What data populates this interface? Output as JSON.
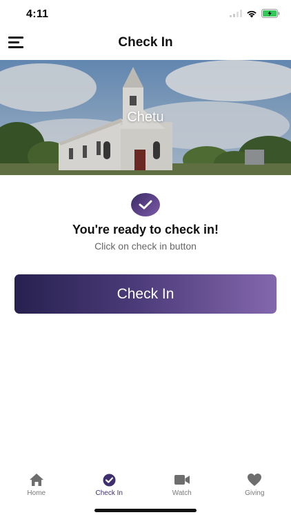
{
  "status_bar": {
    "time": "4:11"
  },
  "header": {
    "title": "Check In",
    "menu_icon": "hamburger-menu-icon"
  },
  "banner": {
    "church_name": "Chetu"
  },
  "checkin": {
    "badge_icon": "checkmark-icon",
    "title": "You're ready to check in!",
    "subtitle": "Click on check in button",
    "button_label": "Check In"
  },
  "tabs": [
    {
      "label": "Home",
      "icon": "home-icon",
      "active": false
    },
    {
      "label": "Check In",
      "icon": "check-circle-icon",
      "active": true
    },
    {
      "label": "Watch",
      "icon": "video-camera-icon",
      "active": false
    },
    {
      "label": "Giving",
      "icon": "heart-icon",
      "active": false
    }
  ],
  "colors": {
    "accent_dark": "#27214f",
    "accent_light": "#8467ad",
    "active_tab": "#3f2f6e",
    "inactive_tab": "#777777",
    "battery_green": "#34c759"
  }
}
